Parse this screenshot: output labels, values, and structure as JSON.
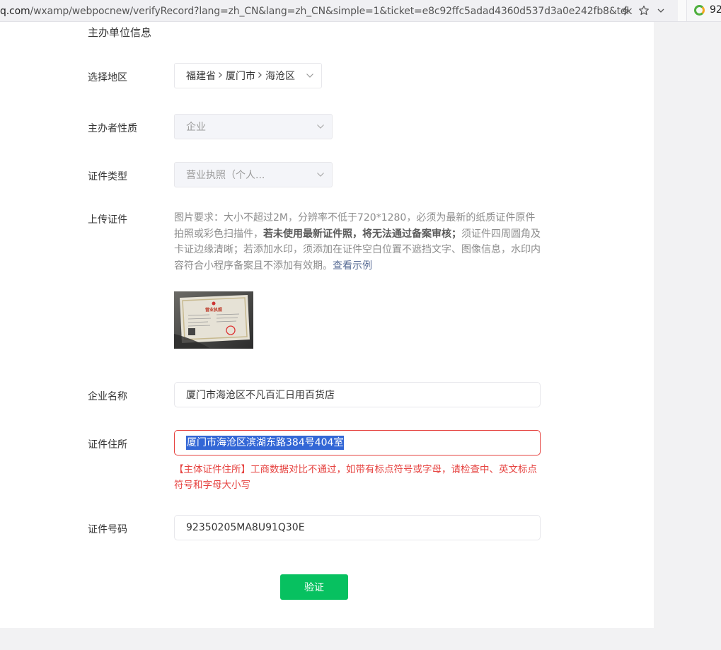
{
  "browser": {
    "url_domain": "q.com",
    "url_path": "/wxamp/webpocnew/verifyRecord?lang=zh_CN&lang=zh_CN&simple=1&ticket=e8c92ffc5adad4360d537d3a0e242fb8&tok",
    "extension_badge_text": "92",
    "icons": [
      "lightning-icon",
      "star-icon",
      "chevron-down-icon",
      "extension-ring-icon"
    ]
  },
  "form": {
    "section_title": "主办单位信息",
    "region": {
      "label": "选择地区",
      "province": "福建省",
      "city": "厦门市",
      "district": "海沧区"
    },
    "sponsor_type": {
      "label": "主办者性质",
      "value": "企业"
    },
    "certificate_type": {
      "label": "证件类型",
      "value": "营业执照（个人..."
    },
    "upload": {
      "label": "上传证件",
      "desc_part1": "图片要求：大小不超过2M，分辨率不低于720*1280，必须为最新的纸质证件原件拍照或彩色扫描件，",
      "desc_bold": "若未使用最新证件照，将无法通过备案审核；",
      "desc_part2": "须证件四周圆角及卡证边缘清晰；若添加水印，须添加在证件空白位置不遮挡文字、图像信息，水印内容符合小程序备案且不添加有效期。",
      "example_link": "查看示例",
      "thumbnail_title": "营业执照"
    },
    "company_name": {
      "label": "企业名称",
      "value": "厦门市海沧区不凡百汇日用百货店"
    },
    "certificate_address": {
      "label": "证件住所",
      "value": "厦门市海沧区滨湖东路384号404室",
      "error": "【主体证件住所】工商数据对比不通过，如带有标点符号或字母，请检查中、英文标点符号和字母大小写"
    },
    "certificate_number": {
      "label": "证件号码",
      "value": "92350205MA8U91Q30E"
    },
    "submit_label": "验证"
  },
  "colors": {
    "primary_green": "#07c160",
    "error_red": "#e64340",
    "link_blue": "#576b95",
    "selection_blue": "#3367d6"
  }
}
